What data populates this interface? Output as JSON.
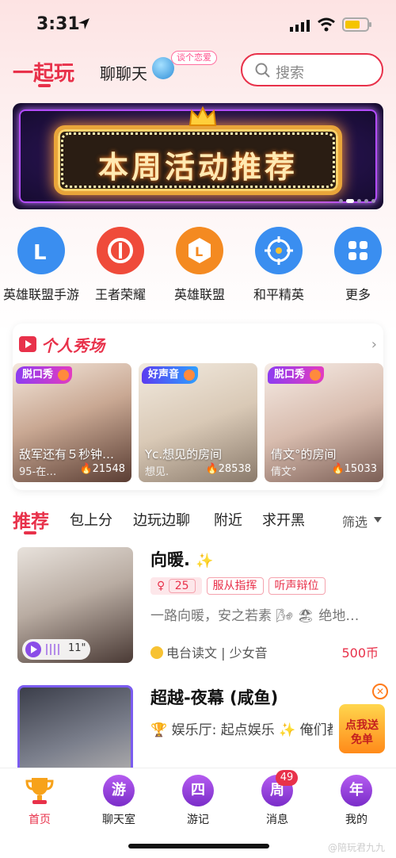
{
  "status_bar": {
    "time": "3:31"
  },
  "header": {
    "tab_main": "一起玩",
    "tab_chat": "聊聊天",
    "chat_badge": "谈个恋爱",
    "search_placeholder": "搜索"
  },
  "banner": {
    "title": "本周活动推荐"
  },
  "games": [
    {
      "label": "英雄联盟手游",
      "icon": "lol-mobile-icon",
      "color": "#3a8ef0"
    },
    {
      "label": "王者荣耀",
      "icon": "honor-of-kings-icon",
      "color": "#ef4b3a"
    },
    {
      "label": "英雄联盟",
      "icon": "lol-icon",
      "color": "#f48a21"
    },
    {
      "label": "和平精英",
      "icon": "peace-elite-icon",
      "color": "#3a8ef0"
    },
    {
      "label": "更多",
      "icon": "more-grid-icon",
      "color": "#3a8ef0"
    }
  ],
  "showcase": {
    "title": "个人秀场",
    "cards": [
      {
        "tag": "脱口秀",
        "name": "敌军还有５秒钟…",
        "sub": "95-在…",
        "hot": "21548"
      },
      {
        "tag": "好声音",
        "name": "Yc.想见的房间",
        "sub": "想见.",
        "hot": "28538"
      },
      {
        "tag": "脱口秀",
        "name": "倩文°的房间",
        "sub": "倩文°",
        "hot": "15033"
      }
    ]
  },
  "categories": {
    "tabs": [
      "推荐",
      "包上分",
      "边玩边聊",
      "附近",
      "求开黑"
    ],
    "filter": "筛选"
  },
  "rooms": [
    {
      "title": "向暖.",
      "age": "25",
      "tags": [
        "服从指挥",
        "听声辩位"
      ],
      "desc": "一路向暖，安之若素 🌬 🏖 绝地…",
      "voice_seconds": "11\"",
      "meta_category": "电台读文",
      "meta_sub": "少女音",
      "price": "500币"
    },
    {
      "title": "超越-夜幕 (咸鱼)",
      "desc": "🏆 娱乐厅: 起点娱乐 ✨ 俺们都是"
    }
  ],
  "promo": {
    "text": "点我送免单"
  },
  "tabbar": [
    {
      "label": "首页",
      "glyph": ""
    },
    {
      "label": "聊天室",
      "glyph": "游"
    },
    {
      "label": "游记",
      "glyph": "四"
    },
    {
      "label": "消息",
      "glyph": "周",
      "badge": "49"
    },
    {
      "label": "我的",
      "glyph": "年"
    }
  ],
  "watermark": "@陪玩君九九"
}
